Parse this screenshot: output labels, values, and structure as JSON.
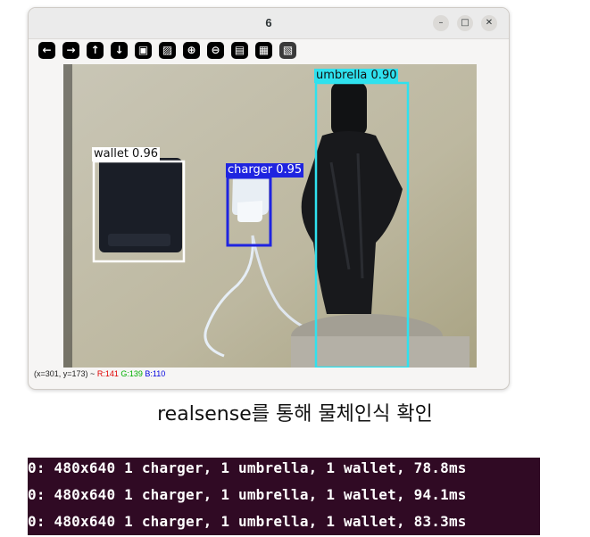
{
  "window": {
    "title": "6",
    "controls": [
      "–",
      "□",
      "✕"
    ]
  },
  "toolbar": [
    {
      "icon": "arrow-left-icon",
      "glyph": "←"
    },
    {
      "icon": "arrow-right-icon",
      "glyph": "→"
    },
    {
      "icon": "arrow-up-icon",
      "glyph": "↑"
    },
    {
      "icon": "arrow-down-icon",
      "glyph": "↓"
    },
    {
      "icon": "image-icon",
      "glyph": "▣"
    },
    {
      "icon": "image-settings-icon",
      "glyph": "▨"
    },
    {
      "icon": "zoom-in-icon",
      "glyph": "⊕"
    },
    {
      "icon": "zoom-out-icon",
      "glyph": "⊖"
    },
    {
      "icon": "save-icon",
      "glyph": "▤"
    },
    {
      "icon": "clipboard-icon",
      "glyph": "▦"
    },
    {
      "icon": "properties-icon",
      "glyph": "▧"
    }
  ],
  "detections": {
    "wallet": "wallet 0.96",
    "charger": "charger 0.95",
    "umbrella": "umbrella 0.90"
  },
  "status": {
    "coords": "(x=301, y=173) ~",
    "r": "R:141",
    "g": "G:139",
    "b": "B:110"
  },
  "caption": "realsense를 통해 물체인식 확인",
  "terminal": [
    "0: 480x640 1 charger, 1 umbrella, 1 wallet, 78.8ms",
    "0: 480x640 1 charger, 1 umbrella, 1 wallet, 94.1ms",
    "0: 480x640 1 charger, 1 umbrella, 1 wallet, 83.3ms"
  ],
  "colors": {
    "wallet_box": "#ffffff",
    "charger_box": "#1f24e0",
    "umbrella_box": "#2fe1ee",
    "terminal_bg": "#300a24"
  }
}
